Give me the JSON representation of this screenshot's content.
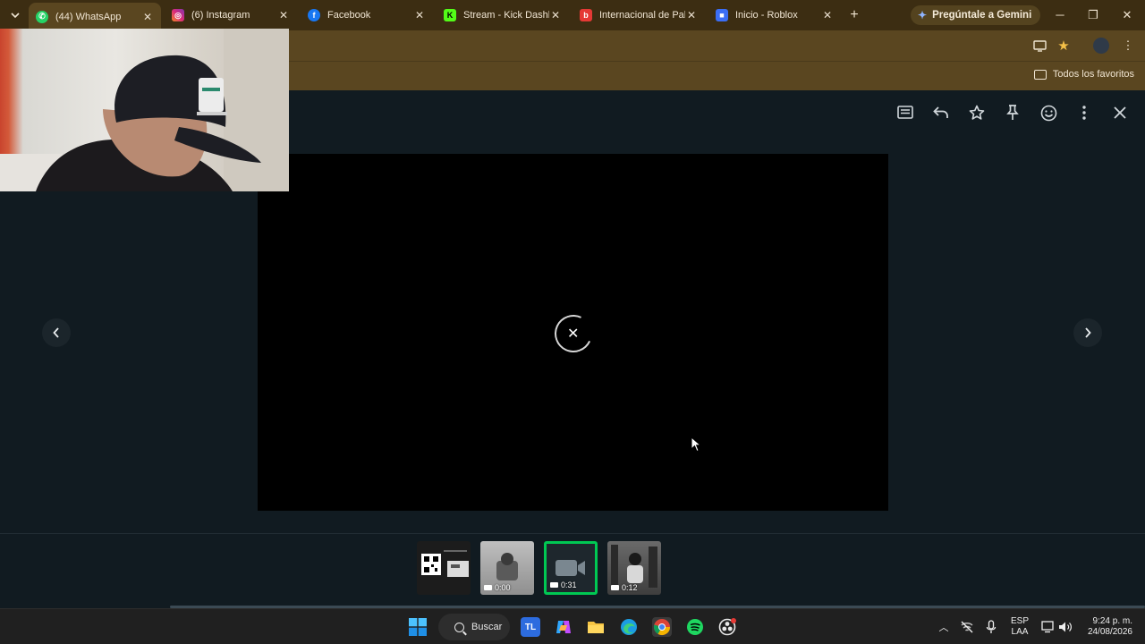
{
  "browser": {
    "tabs": [
      {
        "title": "(44) WhatsApp",
        "icon": "whatsapp-icon",
        "color": "#25d366",
        "active": true
      },
      {
        "title": "(6) Instagram",
        "icon": "instagram-icon",
        "color": "#e1306c"
      },
      {
        "title": "Facebook",
        "icon": "facebook-icon",
        "color": "#1877f2"
      },
      {
        "title": "Stream - Kick Dashbo",
        "icon": "kick-icon",
        "color": "#53fc18"
      },
      {
        "title": "Internacional de Palm",
        "icon": "internacional-icon",
        "color": "#e53935"
      },
      {
        "title": "Inicio - Roblox",
        "icon": "roblox-icon",
        "color": "#3b6ef5"
      }
    ],
    "gemini_label": "Pregúntale a Gemini",
    "bookmarks_all": "Todos los favoritos"
  },
  "viewer": {
    "actions": [
      "message-icon",
      "reply-icon",
      "star-icon",
      "pin-icon",
      "emoji-icon",
      "menu-icon",
      "close-icon"
    ],
    "thumbnails": [
      {
        "kind": "image",
        "duration": ""
      },
      {
        "kind": "video",
        "duration": "0:00"
      },
      {
        "kind": "video",
        "duration": "0:31",
        "selected": true
      },
      {
        "kind": "video",
        "duration": "0:12"
      }
    ]
  },
  "taskbar": {
    "search_label": "Buscar",
    "language": "ESP",
    "keyboard": "LAA",
    "time": "9:24 p. m.",
    "date": "24/08/2026"
  }
}
